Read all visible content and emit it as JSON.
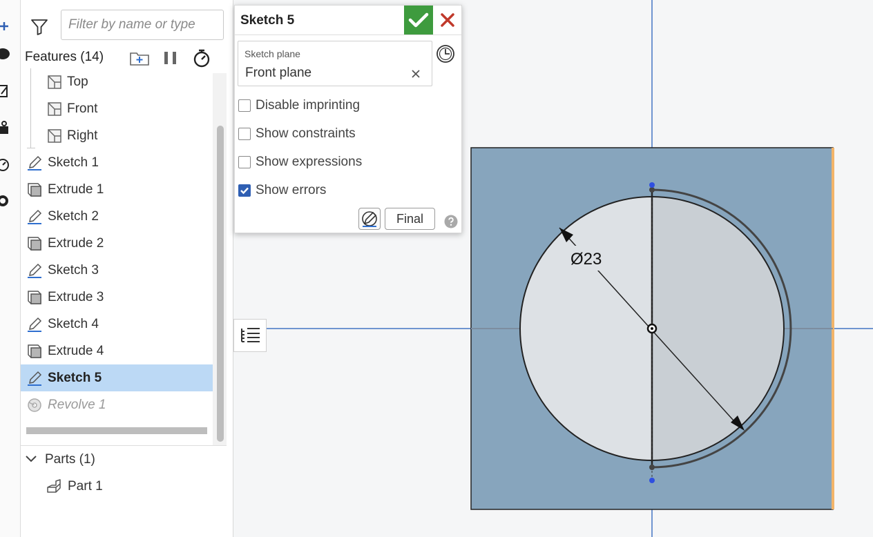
{
  "feature_panel": {
    "filter_placeholder": "Filter by name or type",
    "features_title": "Features (14)",
    "tree": [
      {
        "label": "Top",
        "kind": "plane",
        "icon": "plane-icon"
      },
      {
        "label": "Front",
        "kind": "plane",
        "icon": "plane-icon"
      },
      {
        "label": "Right",
        "kind": "plane",
        "icon": "plane-icon"
      },
      {
        "label": "Sketch 1",
        "kind": "sketch",
        "icon": "pencil-icon"
      },
      {
        "label": "Extrude 1",
        "kind": "extrude",
        "icon": "extrude-icon"
      },
      {
        "label": "Sketch 2",
        "kind": "sketch",
        "icon": "pencil-icon"
      },
      {
        "label": "Extrude 2",
        "kind": "extrude",
        "icon": "extrude-icon"
      },
      {
        "label": "Sketch 3",
        "kind": "sketch",
        "icon": "pencil-icon"
      },
      {
        "label": "Extrude 3",
        "kind": "extrude",
        "icon": "extrude-icon"
      },
      {
        "label": "Sketch 4",
        "kind": "sketch",
        "icon": "pencil-icon"
      },
      {
        "label": "Extrude 4",
        "kind": "extrude",
        "icon": "extrude-icon"
      },
      {
        "label": "Sketch 5",
        "kind": "sketch",
        "icon": "pencil-icon",
        "selected": true
      },
      {
        "label": "Revolve 1",
        "kind": "revolve",
        "icon": "revolve-icon",
        "suppressed": true
      }
    ],
    "parts_title": "Parts (1)",
    "parts": [
      {
        "label": "Part 1",
        "icon": "part-icon"
      }
    ]
  },
  "sketch_dialog": {
    "title": "Sketch 5",
    "plane_caption": "Sketch plane",
    "plane_value": "Front plane",
    "options": [
      {
        "label": "Disable imprinting",
        "checked": false
      },
      {
        "label": "Show constraints",
        "checked": false
      },
      {
        "label": "Show expressions",
        "checked": false
      },
      {
        "label": "Show errors",
        "checked": true
      }
    ],
    "final_label": "Final"
  },
  "viewport": {
    "dimension_label": "Ø23"
  },
  "colors": {
    "accept_green": "#3e9b3e",
    "cancel_red": "#c0392b",
    "selection_blue": "#bcd9f5",
    "part_face": "#87a5bd",
    "sketch_axis": "#6f95d0",
    "edge_orange": "#f2b46a"
  }
}
